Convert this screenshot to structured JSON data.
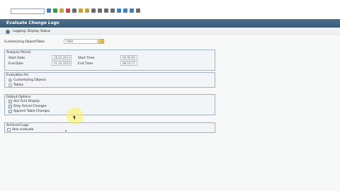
{
  "toolbar": {
    "command_value": "",
    "icons": [
      "save-icon",
      "back-icon",
      "exit-icon",
      "cancel-icon",
      "print-icon",
      "find-icon",
      "find-next-icon",
      "first-page-icon",
      "prev-page-icon",
      "next-page-icon",
      "last-page-icon",
      "new-session-icon",
      "shortcut-icon",
      "help-icon",
      "settings-icon"
    ],
    "icon_colors": [
      "#3f7fbf",
      "#2f9a4a",
      "#c9a13a",
      "#d04040",
      "#6b6b6b",
      "#c9a13a",
      "#c9a13a",
      "#6b6b6b",
      "#6b6b6b",
      "#6b6b6b",
      "#6b6b6b",
      "#3f7fbf",
      "#3f7fbf",
      "#3f7fbf",
      "#6b6b6b"
    ]
  },
  "screen": {
    "title": "Evaluate Change Logs",
    "app_toolbar_label": "Logging: Display Status"
  },
  "customizing": {
    "label": "Customizing Object/Table",
    "value": "T000"
  },
  "analysis_period": {
    "title": "Analysis Period",
    "start_date_label": "Start Date",
    "start_date": "28.03.2013",
    "end_date_label": "End Date",
    "end_date": "31.03.2013",
    "start_time_label": "Start Time",
    "start_time": "00:00:00",
    "end_time_label": "End Time",
    "end_time": "08:14:17"
  },
  "evaluation_for": {
    "title": "Evaluation for",
    "options": [
      {
        "label": "Customizing Objects",
        "selected": true
      },
      {
        "label": "Tables",
        "selected": false
      }
    ]
  },
  "output_options": {
    "title": "Output Options",
    "options": [
      {
        "label": "ALV Grid Display",
        "checked": true
      },
      {
        "label": "Only Actual Changes",
        "checked": true
      },
      {
        "label": "Append Table Changes",
        "checked": true
      }
    ]
  },
  "archived_logs": {
    "title": "Archived Logs",
    "option": {
      "label": "Also evaluate",
      "checked": false
    }
  },
  "colors": {
    "title_bar": "#3a5b76",
    "group_border": "#9fb2c4",
    "background": "#f7f8f8"
  }
}
